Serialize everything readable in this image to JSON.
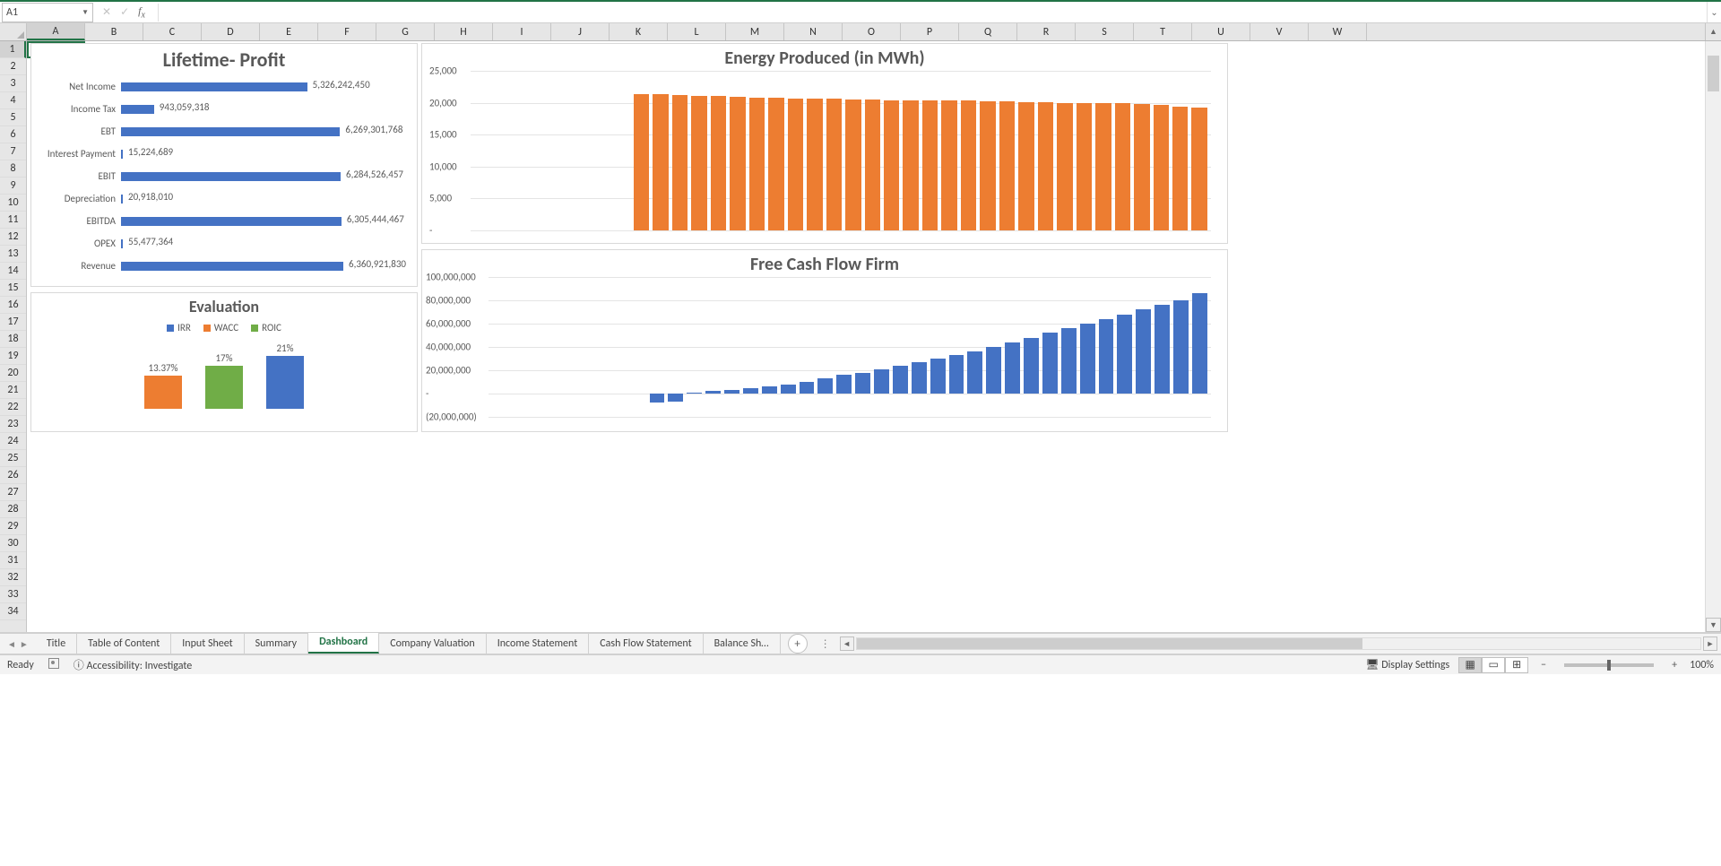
{
  "active_cell": "A1",
  "formula_value": "",
  "column_letters": [
    "A",
    "B",
    "C",
    "D",
    "E",
    "F",
    "G",
    "H",
    "I",
    "J",
    "K",
    "L",
    "M",
    "N",
    "O",
    "P",
    "Q",
    "R",
    "S",
    "T",
    "U",
    "V",
    "W"
  ],
  "row_count": 34,
  "sheet_tabs": [
    "Title",
    "Table of Content",
    "Input Sheet",
    "Summary",
    "Dashboard",
    "Company Valuation",
    "Income Statement",
    "Cash Flow Statement",
    "Balance Sh…"
  ],
  "active_tab_index": 4,
  "status": {
    "ready": "Ready",
    "accessibility": "Accessibility: Investigate",
    "display": "Display Settings",
    "zoom": "100%"
  },
  "colors": {
    "blue": "#4472C4",
    "orange": "#ED7D31",
    "green": "#70AD47"
  },
  "chart_data": [
    {
      "id": "profit",
      "type": "bar",
      "orientation": "horizontal",
      "title": "Lifetime- Profit",
      "categories": [
        "Net Income",
        "Income Tax",
        "EBT",
        "Interest Payment",
        "EBIT",
        "Depreciation",
        "EBITDA",
        "OPEX",
        "Revenue"
      ],
      "values": [
        5326242450,
        943059318,
        6269301768,
        15224689,
        6284526457,
        20918010,
        6305444467,
        55477364,
        6360921830
      ],
      "value_labels": [
        "5,326,242,450",
        "943,059,318",
        "6,269,301,768",
        "15,224,689",
        "6,284,526,457",
        "20,918,010",
        "6,305,444,467",
        "55,477,364",
        "6,360,921,830"
      ],
      "max_for_scale": 6360921830,
      "color": "#4472C4"
    },
    {
      "id": "evaluation",
      "type": "bar",
      "title": "Evaluation",
      "categories": [
        "IRR",
        "WACC",
        "ROIC"
      ],
      "values": [
        0.1337,
        0.17,
        0.21
      ],
      "value_labels": [
        "13.37%",
        "17%",
        "21%"
      ],
      "colors": [
        "#ED7D31",
        "#70AD47",
        "#4472C4"
      ],
      "legend": [
        {
          "name": "IRR",
          "color": "#4472C4"
        },
        {
          "name": "WACC",
          "color": "#ED7D31"
        },
        {
          "name": "ROIC",
          "color": "#70AD47"
        }
      ]
    },
    {
      "id": "energy",
      "type": "bar",
      "title": "Energy Produced (in MWh)",
      "ylim": [
        0,
        25000
      ],
      "ytick_labels": [
        "25,000",
        "20,000",
        "15,000",
        "10,000",
        "5,000",
        "-"
      ],
      "ytick_values": [
        25000,
        20000,
        15000,
        10000,
        5000,
        0
      ],
      "lead_empty": 4,
      "values": [
        21300,
        21300,
        21200,
        21100,
        21000,
        20900,
        20800,
        20800,
        20700,
        20600,
        20600,
        20500,
        20500,
        20400,
        20400,
        20300,
        20300,
        20300,
        20200,
        20200,
        20100,
        20100,
        20000,
        20000,
        19900,
        19900,
        19800,
        19600,
        19400,
        19200
      ],
      "color": "#ED7D31"
    },
    {
      "id": "cashflow",
      "type": "bar",
      "title": "Free Cash Flow Firm",
      "ylim": [
        -20000000,
        100000000
      ],
      "ytick_labels": [
        "100,000,000",
        "80,000,000",
        "60,000,000",
        "40,000,000",
        "20,000,000",
        "-",
        "(20,000,000)"
      ],
      "ytick_values": [
        100000000,
        80000000,
        60000000,
        40000000,
        20000000,
        0,
        -20000000
      ],
      "lead_empty": 4,
      "values": [
        -8000000,
        -7000000,
        1000000,
        2000000,
        3000000,
        4500000,
        6000000,
        8000000,
        10000000,
        13000000,
        16000000,
        18000000,
        21000000,
        24000000,
        27000000,
        30000000,
        33000000,
        36000000,
        40000000,
        44000000,
        48000000,
        52000000,
        56000000,
        60000000,
        64000000,
        68000000,
        72000000,
        76000000,
        80000000,
        86000000
      ],
      "color": "#4472C4"
    }
  ]
}
